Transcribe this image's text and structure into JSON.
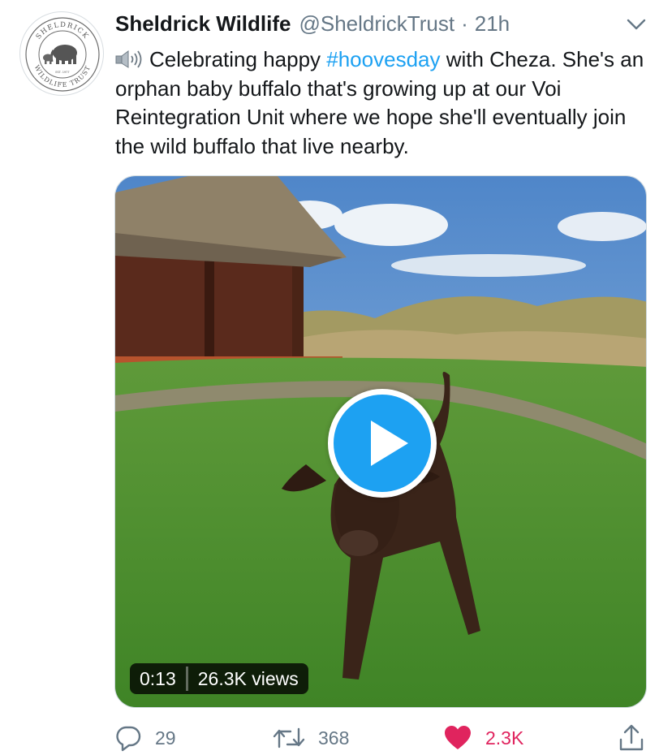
{
  "account": {
    "display_name": "Sheldrick Wildlife",
    "handle": "@SheldrickTrust",
    "separator": "·",
    "time_ago": "21h",
    "avatar_text_top": "SHELDRICK",
    "avatar_text_bottom": "WILDLIFE TRUST",
    "avatar_text_est": "EST. 1977"
  },
  "tweet": {
    "text_before_hashtag": "Celebrating happy ",
    "hashtag": "#hoovesday",
    "text_after_hashtag": " with Cheza. She's an orphan baby buffalo that's growing up at our Voi Reintegration Unit where we hope she'll eventually join the wild buffalo that live nearby."
  },
  "media": {
    "duration": "0:13",
    "views": "26.3K views",
    "play_icon": "play-icon"
  },
  "actions": {
    "replies": "29",
    "retweets": "368",
    "likes": "2.3K",
    "liked": true,
    "like_color": "#e0245e"
  },
  "colors": {
    "link": "#1da1f2",
    "secondary_text": "#657786",
    "primary_text": "#14171a"
  }
}
